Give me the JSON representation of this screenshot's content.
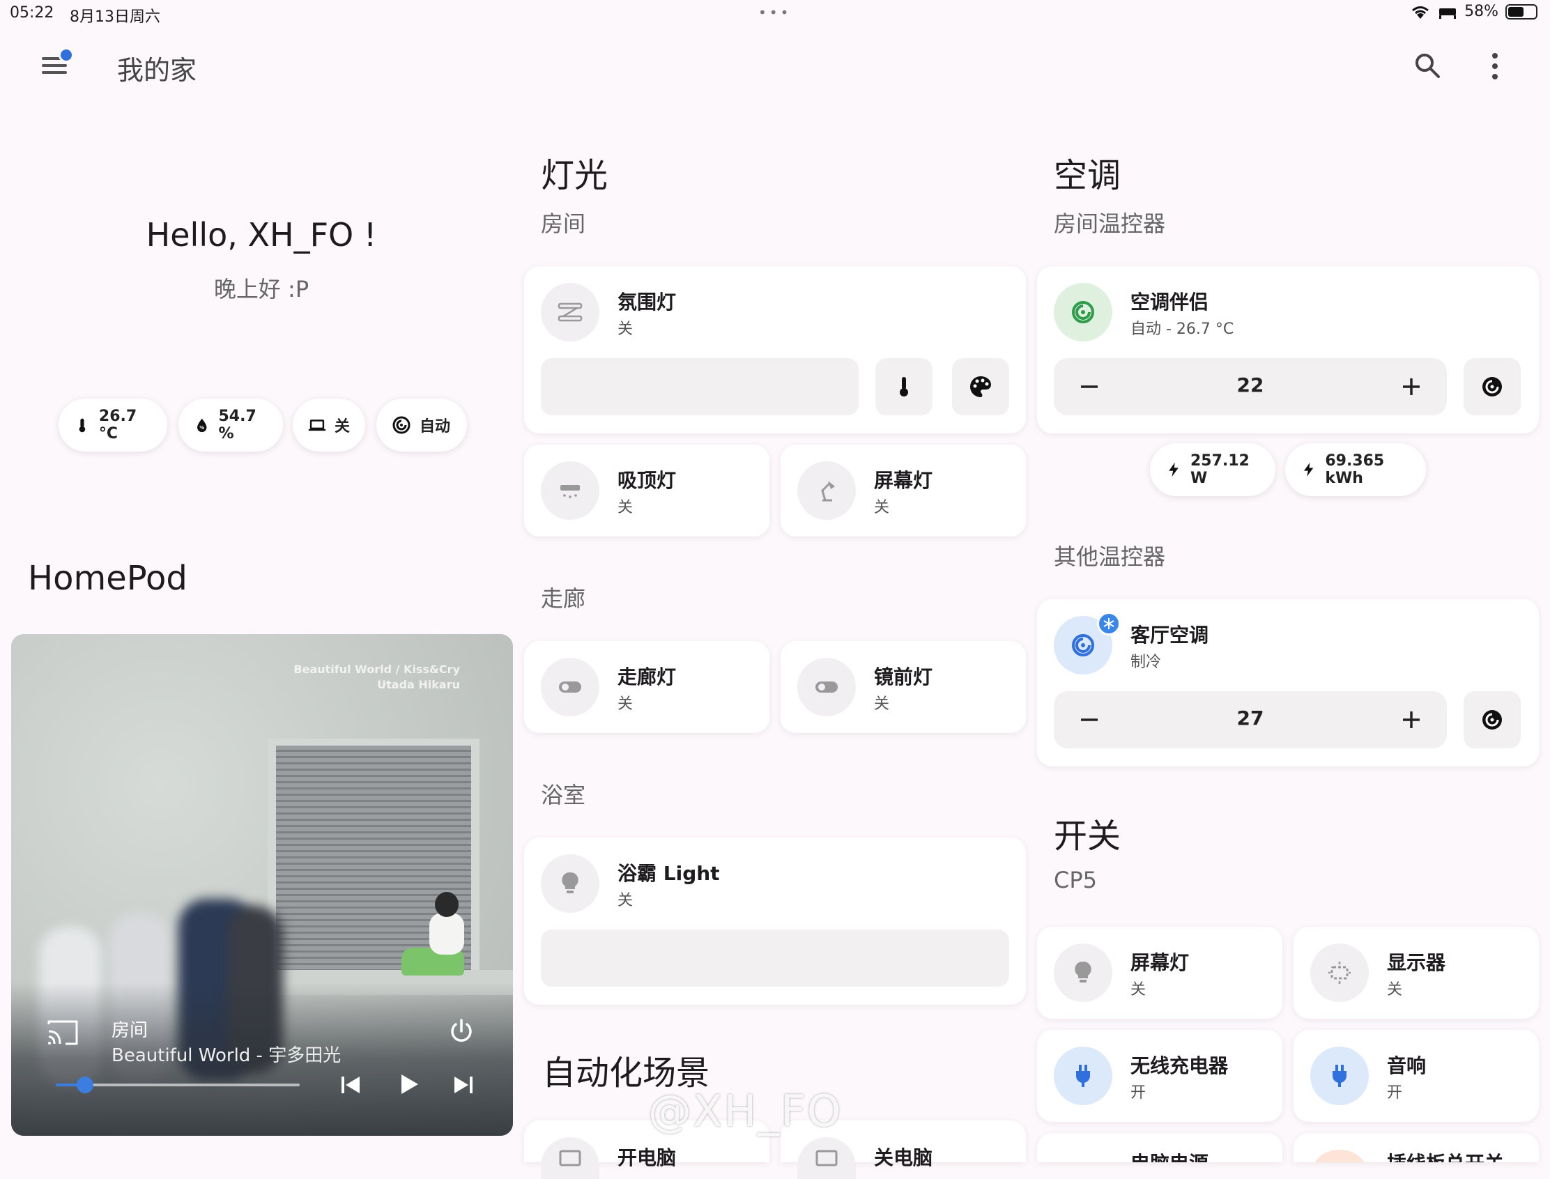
{
  "status_bar": {
    "time": "05:22",
    "date": "8月13日周六",
    "dots": "•••",
    "battery_pct": "58%",
    "battery_level": 0.58
  },
  "header": {
    "title": "我的家"
  },
  "greeting": {
    "title": "Hello, XH_FO !",
    "subtitle": "晚上好 :P"
  },
  "chips": [
    {
      "label": "26.7 °C",
      "icon": "thermometer-icon"
    },
    {
      "label": "54.7 %",
      "icon": "humidity-icon"
    },
    {
      "label": "关",
      "icon": "laptop-icon"
    },
    {
      "label": "自动",
      "icon": "thermostat-icon"
    }
  ],
  "homepod": {
    "title": "HomePod",
    "album_text_1": "Beautiful World / Kiss&Cry",
    "album_text_2": "Utada Hikaru",
    "room": "房间",
    "song": "Beautiful World - 宇多田光",
    "progress": 0.12
  },
  "lights": {
    "title": "灯光",
    "room_section": "房间",
    "ambient": {
      "name": "氛围灯",
      "state": "关"
    },
    "ceiling": {
      "name": "吸顶灯",
      "state": "关"
    },
    "screen_lamp": {
      "name": "屏幕灯",
      "state": "关"
    },
    "hall_section": "走廊",
    "hall_light": {
      "name": "走廊灯",
      "state": "关"
    },
    "mirror_light": {
      "name": "镜前灯",
      "state": "关"
    },
    "bath_section": "浴室",
    "bath_light": {
      "name": "浴霸 Light",
      "state": "关"
    }
  },
  "automation": {
    "title": "自动化场景",
    "on_pc": {
      "name": "开电脑"
    },
    "off_pc": {
      "name": "关电脑"
    }
  },
  "climate": {
    "title": "空调",
    "room_section": "房间温控器",
    "companion": {
      "name": "空调伴侣",
      "state": "自动 - 26.7 °C",
      "setpoint": "22"
    },
    "power_chip": "257.12 W",
    "energy_chip": "69.365 kWh",
    "other_section": "其他温控器",
    "living": {
      "name": "客厅空调",
      "state": "制冷",
      "setpoint": "27"
    }
  },
  "switches": {
    "title": "开关",
    "group": "CP5",
    "screen_lamp": {
      "name": "屏幕灯",
      "state": "关"
    },
    "monitor": {
      "name": "显示器",
      "state": "关"
    },
    "charger": {
      "name": "无线充电器",
      "state": "开"
    },
    "speaker": {
      "name": "音响",
      "state": "开"
    },
    "pc_power": {
      "name": "电脑电源"
    },
    "strip_switch": {
      "name": "插线板总开关"
    }
  },
  "watermark": "@XH_FO",
  "colors": {
    "accent": "#3b7de0",
    "on_blue": "#dbe9fb",
    "green": "#dff0df",
    "bg": "#fdf8fb"
  }
}
